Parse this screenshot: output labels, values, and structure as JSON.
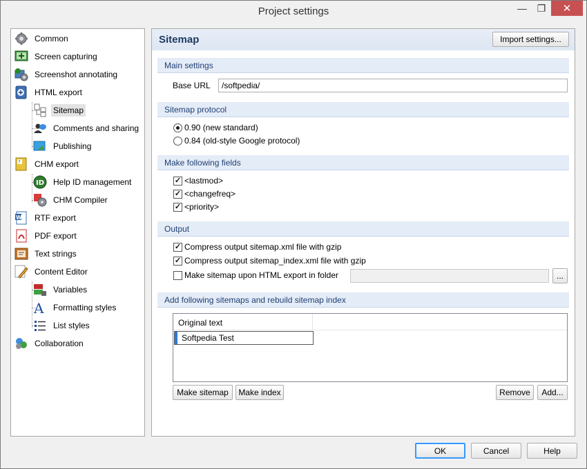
{
  "window": {
    "title": "Project settings"
  },
  "titlebar": {
    "minimize": "—",
    "maximize": "❐",
    "close": "✕"
  },
  "tree": {
    "items": [
      {
        "label": "Common",
        "icon": "gear-icon"
      },
      {
        "label": "Screen capturing",
        "icon": "screen-capture-icon"
      },
      {
        "label": "Screenshot annotating",
        "icon": "annotate-icon"
      },
      {
        "label": "HTML export",
        "icon": "html-export-icon"
      },
      {
        "label": "Sitemap",
        "icon": "sitemap-icon"
      },
      {
        "label": "Comments and sharing",
        "icon": "comments-icon"
      },
      {
        "label": "Publishing",
        "icon": "publishing-icon"
      },
      {
        "label": "CHM export",
        "icon": "chm-export-icon"
      },
      {
        "label": "Help ID management",
        "icon": "help-id-icon"
      },
      {
        "label": "CHM Compiler",
        "icon": "chm-compiler-icon"
      },
      {
        "label": "RTF export",
        "icon": "rtf-export-icon"
      },
      {
        "label": "PDF export",
        "icon": "pdf-export-icon"
      },
      {
        "label": "Text strings",
        "icon": "text-strings-icon"
      },
      {
        "label": "Content Editor",
        "icon": "pencil-icon"
      },
      {
        "label": "Variables",
        "icon": "variables-icon"
      },
      {
        "label": "Formatting styles",
        "icon": "formatting-icon"
      },
      {
        "label": "List styles",
        "icon": "list-icon"
      },
      {
        "label": "Collaboration",
        "icon": "collaboration-icon"
      }
    ]
  },
  "panel": {
    "title": "Sitemap",
    "import_button": "Import settings...",
    "main_settings": {
      "header": "Main settings",
      "base_url_label": "Base URL",
      "base_url_value": "/softpedia/"
    },
    "protocol": {
      "header": "Sitemap protocol",
      "options": [
        "0.90 (new standard)",
        "0.84 (old-style Google protocol)"
      ],
      "selected": 0
    },
    "fields": {
      "header": "Make following fields",
      "items": [
        {
          "label": "<lastmod>",
          "checked": true
        },
        {
          "label": "<changefreq>",
          "checked": true
        },
        {
          "label": "<priority>",
          "checked": true
        }
      ]
    },
    "output": {
      "header": "Output",
      "items": [
        {
          "label": "Compress output sitemap.xml file with gzip",
          "checked": true
        },
        {
          "label": "Compress output sitemap_index.xml file with gzip",
          "checked": true
        },
        {
          "label": "Make sitemap upon HTML export in folder",
          "checked": false
        }
      ],
      "folder_value": "",
      "browse_button": "..."
    },
    "sitemaps": {
      "header": "Add following sitemaps and rebuild sitemap index",
      "column": "Original text",
      "rows": [
        "Softpedia Test"
      ],
      "make_sitemap_button": "Make sitemap",
      "make_index_button": "Make index",
      "remove_button": "Remove",
      "add_button": "Add..."
    }
  },
  "footer": {
    "ok": "OK",
    "cancel": "Cancel",
    "help": "Help"
  },
  "colors": {
    "accent": "#3399ff",
    "section_bg": "#e4ecf7",
    "close_red": "#c75050"
  }
}
